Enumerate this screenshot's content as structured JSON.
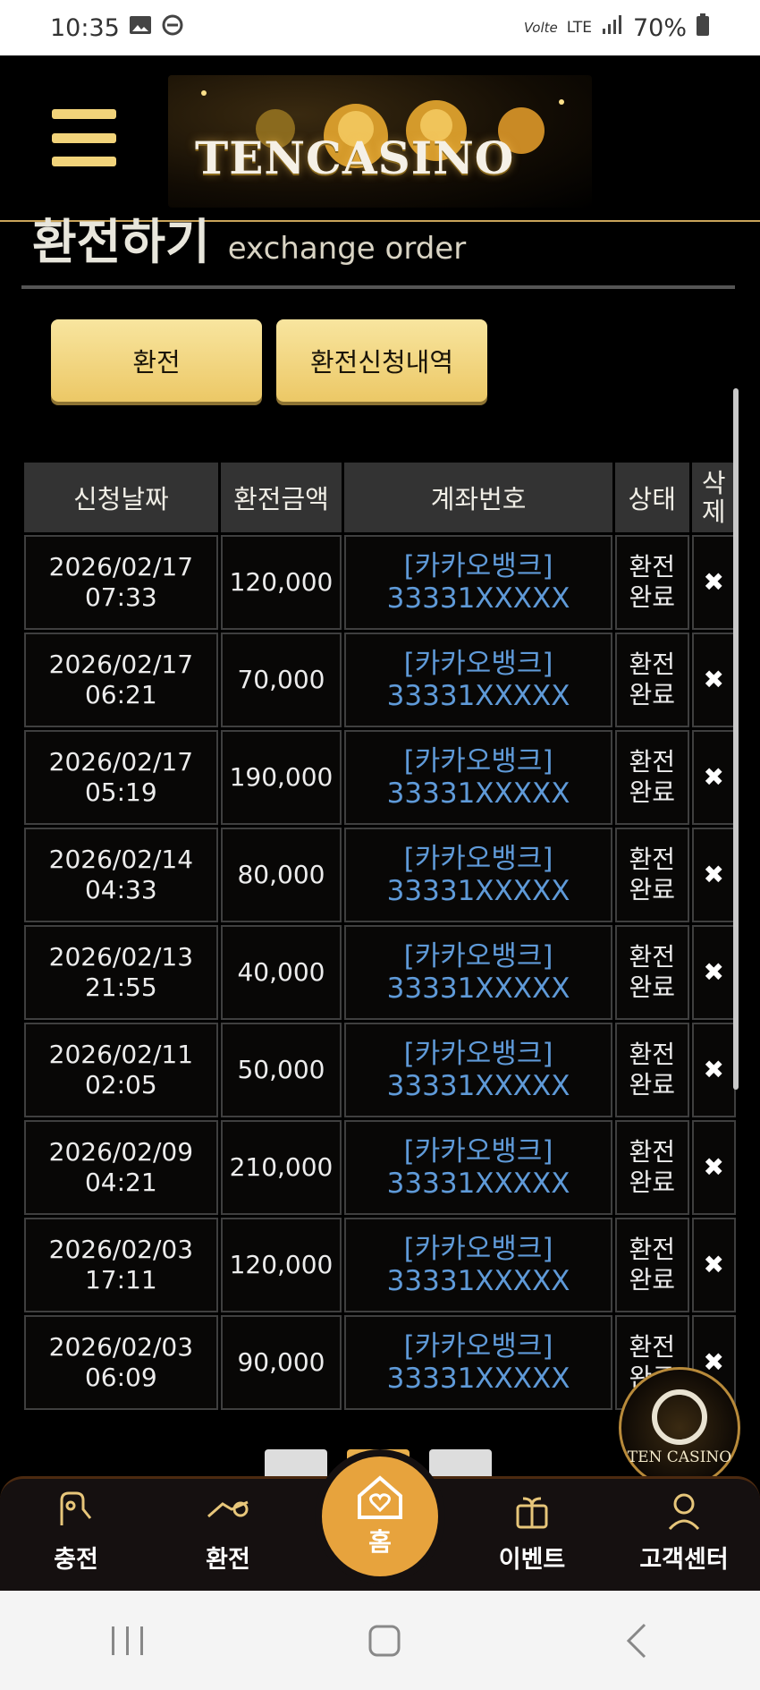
{
  "status_bar": {
    "time": "10:35",
    "network": "LTE",
    "network_prefix": "Vo",
    "battery": "70%",
    "left_icons": [
      "image-icon",
      "do-not-disturb-icon"
    ],
    "right_icons": [
      "volte-icon",
      "lte-icon",
      "signal-icon",
      "battery-icon"
    ]
  },
  "header": {
    "logo_text": "TENCASINO",
    "menu_icon": "hamburger-icon"
  },
  "page": {
    "title_ko": "환전하기",
    "title_en": "exchange order"
  },
  "tabs": [
    {
      "label": "환전"
    },
    {
      "label": "환전신청내역"
    }
  ],
  "table": {
    "columns": [
      "신청날짜",
      "환전금액",
      "계좌번호",
      "상태",
      "삭\n제"
    ],
    "rows": [
      {
        "date": "2026/02/17",
        "time": "07:33",
        "amount": "120,000",
        "bank": "[카카오뱅크]",
        "account": "33331XXXXX",
        "status": "환전\n완료"
      },
      {
        "date": "2026/02/17",
        "time": "06:21",
        "amount": "70,000",
        "bank": "[카카오뱅크]",
        "account": "33331XXXXX",
        "status": "환전\n완료"
      },
      {
        "date": "2026/02/17",
        "time": "05:19",
        "amount": "190,000",
        "bank": "[카카오뱅크]",
        "account": "33331XXXXX",
        "status": "환전\n완료"
      },
      {
        "date": "2026/02/14",
        "time": "04:33",
        "amount": "80,000",
        "bank": "[카카오뱅크]",
        "account": "33331XXXXX",
        "status": "환전\n완료"
      },
      {
        "date": "2026/02/13",
        "time": "21:55",
        "amount": "40,000",
        "bank": "[카카오뱅크]",
        "account": "33331XXXXX",
        "status": "환전\n완료"
      },
      {
        "date": "2026/02/11",
        "time": "02:05",
        "amount": "50,000",
        "bank": "[카카오뱅크]",
        "account": "33331XXXXX",
        "status": "환전\n완료"
      },
      {
        "date": "2026/02/09",
        "time": "04:21",
        "amount": "210,000",
        "bank": "[카카오뱅크]",
        "account": "33331XXXXX",
        "status": "환전\n완료"
      },
      {
        "date": "2026/02/03",
        "time": "17:11",
        "amount": "120,000",
        "bank": "[카카오뱅크]",
        "account": "33331XXXXX",
        "status": "환전\n완료"
      },
      {
        "date": "2026/02/03",
        "time": "06:09",
        "amount": "90,000",
        "bank": "[카카오뱅크]",
        "account": "33331XXXXX",
        "status": "환전\n완료"
      }
    ],
    "delete_icon": "✖"
  },
  "pager": {
    "prev": "‹",
    "next": "›"
  },
  "floating": {
    "logo_text": "TEN CASINO"
  },
  "bottom_nav": [
    {
      "label": "충전",
      "icon": "charge-icon"
    },
    {
      "label": "환전",
      "icon": "exchange-icon"
    },
    {
      "label": "홈",
      "icon": "home-heart-icon"
    },
    {
      "label": "이벤트",
      "icon": "gift-icon"
    },
    {
      "label": "고객센터",
      "icon": "support-icon"
    }
  ],
  "system_nav": {
    "recents": "|||",
    "home": "○",
    "back": "‹"
  },
  "colors": {
    "accent_gold": "#ecc866",
    "account_blue": "#5f9ad8",
    "home_orange": "#e7a33d"
  }
}
